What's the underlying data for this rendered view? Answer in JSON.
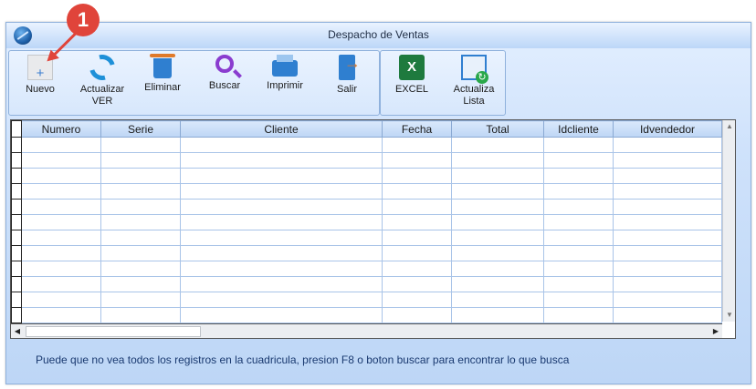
{
  "window": {
    "title": "Despacho de Ventas"
  },
  "toolbar": {
    "nuevo": "Nuevo",
    "actualizar_1": "Actualizar",
    "actualizar_2": "VER",
    "eliminar": "Eliminar",
    "buscar": "Buscar",
    "imprimir": "Imprimir",
    "salir": "Salir",
    "excel": "EXCEL",
    "actualiza_1": "Actualiza",
    "actualiza_2": "Lista"
  },
  "icons": [
    "app-logo-icon",
    "new-document-icon",
    "refresh-icon",
    "trash-icon",
    "search-icon",
    "printer-icon",
    "exit-icon",
    "excel-icon",
    "refresh-list-icon"
  ],
  "grid": {
    "columns": [
      "Numero",
      "Serie",
      "Cliente",
      "Fecha",
      "Total",
      "Idcliente",
      "Idvendedor"
    ],
    "empty_rows": 12
  },
  "status": "Puede que no vea todos los registros en la cuadricula, presion F8 o boton buscar para encontrar lo que busca",
  "annotation": {
    "badge": "1"
  },
  "colors": {
    "accent": "#2f7fd0",
    "badge": "#e0443a",
    "excel": "#1e7a3e"
  }
}
